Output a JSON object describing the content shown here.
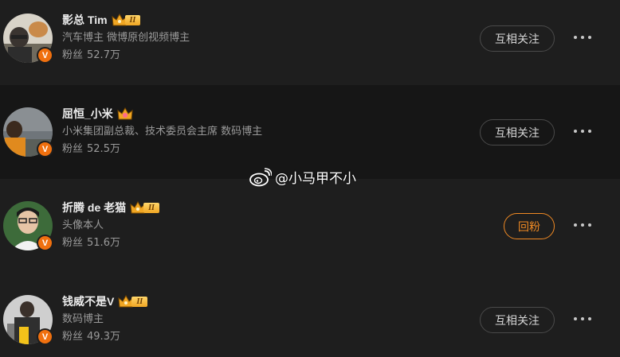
{
  "users": [
    {
      "name": "影总 Tim",
      "level_badge": "II",
      "verified_mark": "V",
      "description": "汽车博主 微博原创视频博主",
      "fans_label": "粉丝",
      "fans_count": "52.7万",
      "follow_button": "互相关注",
      "follow_highlighted": false
    },
    {
      "name": "屈恒_小米",
      "level_badge": "",
      "verified_mark": "V",
      "description": "小米集团副总裁、技术委员会主席 数码博主",
      "fans_label": "粉丝",
      "fans_count": "52.5万",
      "follow_button": "互相关注",
      "follow_highlighted": false
    },
    {
      "name": "折腾 de 老猫",
      "level_badge": "II",
      "verified_mark": "V",
      "description": "头像本人",
      "fans_label": "粉丝",
      "fans_count": "51.6万",
      "follow_button": "回粉",
      "follow_highlighted": true
    },
    {
      "name": "钱威不是V",
      "level_badge": "II",
      "verified_mark": "V",
      "description": "数码博主",
      "fans_label": "粉丝",
      "fans_count": "49.3万",
      "follow_button": "互相关注",
      "follow_highlighted": false
    }
  ],
  "watermark": {
    "text": "@小马甲不小",
    "icon": "weibo-logo-icon"
  },
  "colors": {
    "background": "#1a1a1a",
    "accent": "#f08a24",
    "verified": "#f0700f",
    "level_gold": "#f0a623"
  }
}
